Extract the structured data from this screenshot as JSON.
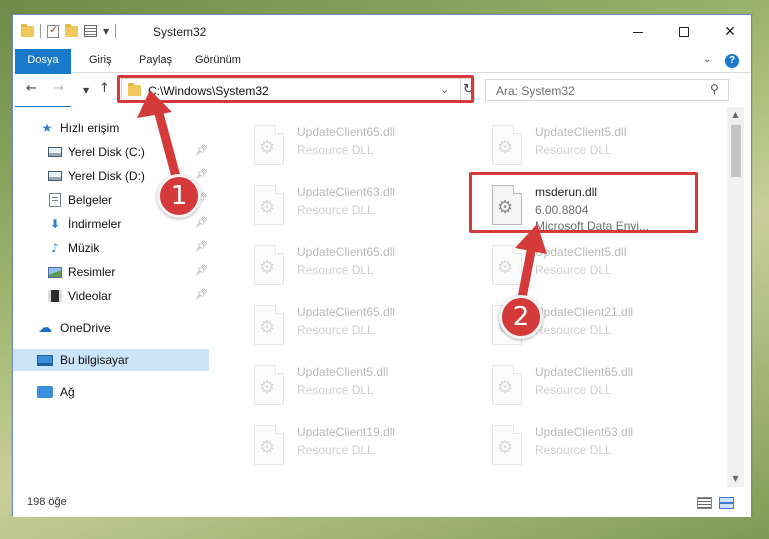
{
  "window": {
    "title": "System32",
    "controls": {
      "minimize_icon": "minimize-icon",
      "maximize_icon": "maximize-icon",
      "close_icon": "close-icon"
    }
  },
  "ribbon": {
    "tabs": [
      {
        "label": "Dosya",
        "active": true
      },
      {
        "label": "Giriş"
      },
      {
        "label": "Paylaş"
      },
      {
        "label": "Görünüm"
      }
    ],
    "help_label": "?"
  },
  "address": {
    "path": "C:\\Windows\\System32"
  },
  "search": {
    "placeholder": "Ara: System32"
  },
  "sidebar": {
    "items": [
      {
        "label": "Hızlı erişim",
        "icon": "star-icon",
        "pinned": false
      },
      {
        "label": "Yerel Disk (C:)",
        "icon": "disk-icon",
        "pinned": true
      },
      {
        "label": "Yerel Disk (D:)",
        "icon": "disk-icon",
        "pinned": true
      },
      {
        "label": "Belgeler",
        "icon": "document-icon",
        "pinned": true
      },
      {
        "label": "İndirmeler",
        "icon": "download-icon",
        "pinned": true
      },
      {
        "label": "Müzik",
        "icon": "music-icon",
        "pinned": true
      },
      {
        "label": "Resimler",
        "icon": "picture-icon",
        "pinned": true
      },
      {
        "label": "Videolar",
        "icon": "video-icon",
        "pinned": true
      },
      {
        "label": "OneDrive",
        "icon": "cloud-icon",
        "pinned": false
      },
      {
        "label": "Bu bilgisayar",
        "icon": "computer-icon",
        "pinned": false,
        "selected": true
      },
      {
        "label": "Ağ",
        "icon": "network-icon",
        "pinned": false
      }
    ]
  },
  "files": {
    "left": [
      {
        "name": "UpdateClient65.dll",
        "type": "Resource DLL"
      },
      {
        "name": "UpdateClient63.dll",
        "type": "Resource DLL"
      },
      {
        "name": "UpdateClient65.dll",
        "type": "Resource DLL"
      },
      {
        "name": "UpdateClient65.dll",
        "type": "Resource DLL"
      },
      {
        "name": "UpdateClient5.dll",
        "type": "Resource DLL"
      },
      {
        "name": "UpdateClient19.dll",
        "type": "Resource DLL"
      }
    ],
    "right": [
      {
        "name": "UpdateClient5.dll",
        "type": "Resource DLL"
      },
      {
        "name": "msderun.dll",
        "version": "6.00.8804",
        "description": "Microsoft Data Envi...",
        "highlighted": true
      },
      {
        "name": "UpdateClient5.dll",
        "type": "Resource DLL"
      },
      {
        "name": "UpdateClient21.dll",
        "type": "Resource DLL"
      },
      {
        "name": "UpdateClient65.dll",
        "type": "Resource DLL"
      },
      {
        "name": "UpdateClient63.dll",
        "type": "Resource DLL"
      }
    ]
  },
  "status": {
    "item_count": "198 öğe"
  },
  "annotations": {
    "step1": "1",
    "step2": "2",
    "highlight_color": "#d43a3a"
  }
}
